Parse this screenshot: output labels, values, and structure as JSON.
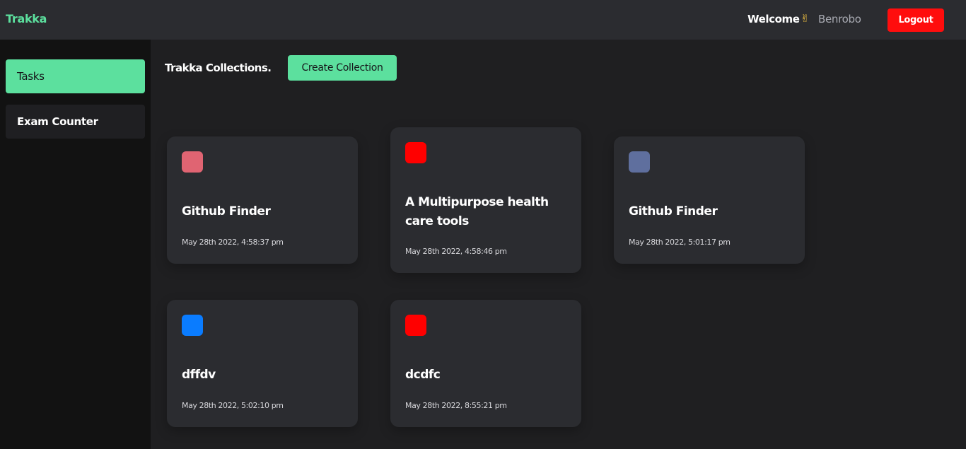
{
  "header": {
    "brand": "Trakka",
    "welcome": "Welcome",
    "wave_icon": "✌",
    "username": "Benrobo",
    "logout_label": "Logout"
  },
  "sidebar": {
    "items": [
      {
        "label": "Tasks",
        "active": true
      },
      {
        "label": "Exam Counter",
        "active": false
      }
    ]
  },
  "main": {
    "title": "Trakka Collections.",
    "create_label": "Create Collection",
    "collections": [
      {
        "title": "Github Finder",
        "date": "May 28th 2022, 4:58:37 pm",
        "color": "#e06472"
      },
      {
        "title": "A Multipurpose health care tools",
        "date": "May 28th 2022, 4:58:46 pm",
        "color": "#ff0000"
      },
      {
        "title": "Github Finder",
        "date": "May 28th 2022, 5:01:17 pm",
        "color": "#5f6f9e"
      },
      {
        "title": "dffdv",
        "date": "May 28th 2022, 5:02:10 pm",
        "color": "#0a7cff"
      },
      {
        "title": "dcdfc",
        "date": "May 28th 2022, 8:55:21 pm",
        "color": "#ff0000"
      }
    ]
  },
  "colors": {
    "accent": "#5ce09e",
    "danger": "#ff0d0d",
    "topbar": "#2b2c30",
    "sidebar": "#121212",
    "background": "#1f1f21",
    "card": "#2b2c30"
  }
}
